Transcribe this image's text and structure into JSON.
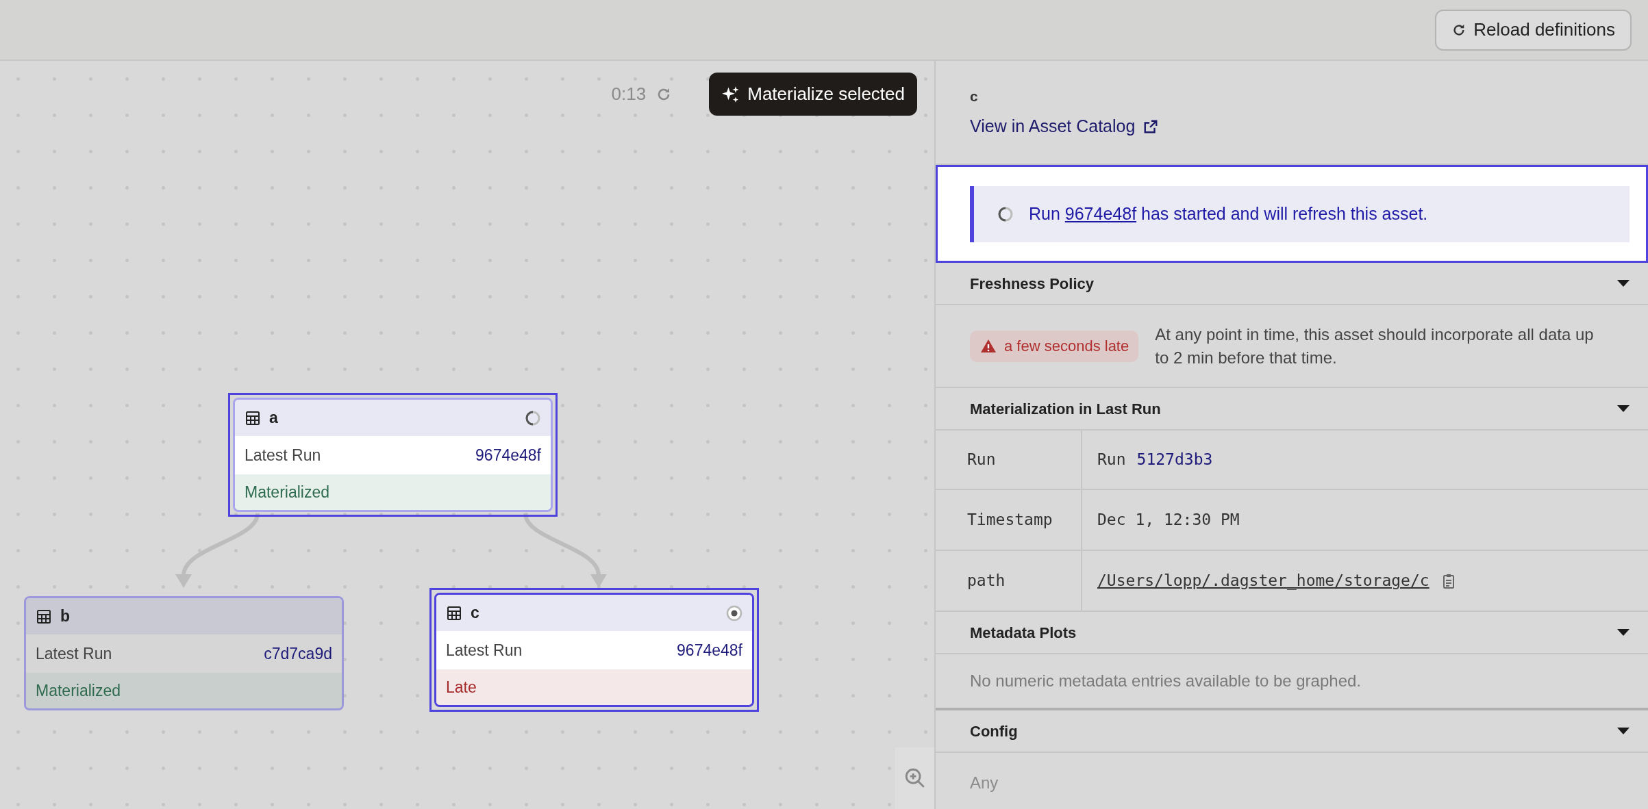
{
  "toolbar": {
    "reload_button": "Reload definitions"
  },
  "canvas": {
    "timer": "0:13",
    "materialize_button": "Materialize selected",
    "nodes": [
      {
        "name": "a",
        "row_label": "Latest Run",
        "run_id": "9674e48f",
        "status": "Materialized",
        "late": false,
        "selected": true,
        "spinner": true,
        "dot": false
      },
      {
        "name": "b",
        "row_label": "Latest Run",
        "run_id": "c7d7ca9d",
        "status": "Materialized",
        "late": false,
        "selected": false,
        "spinner": false,
        "dot": false
      },
      {
        "name": "c",
        "row_label": "Latest Run",
        "run_id": "9674e48f",
        "status": "Late",
        "late": true,
        "selected": true,
        "spinner": false,
        "dot": true
      }
    ]
  },
  "panel": {
    "asset_name": "c",
    "catalog_link": "View in Asset Catalog",
    "banner": {
      "prefix": "Run",
      "link": "9674e48f",
      "suffix": "has started and will refresh this asset."
    },
    "sections": [
      {
        "title": "Freshness Policy",
        "expanded": true,
        "kind": "freshness",
        "badge": "a few seconds late",
        "text": "At any point in time, this asset should incorporate all data up to 2 min before that time."
      },
      {
        "title": "Materialization in Last Run",
        "expanded": true,
        "kind": "table",
        "rows": [
          {
            "key": "Run",
            "kind": "run",
            "prefix": "Run",
            "value": "5127d3b3"
          },
          {
            "key": "Timestamp",
            "kind": "text",
            "value": "Dec 1, 12:30 PM"
          },
          {
            "key": "path",
            "kind": "path",
            "value": "/Users/lopp/.dagster_home/storage/c"
          }
        ]
      },
      {
        "title": "Metadata Plots",
        "expanded": true,
        "kind": "note",
        "text": "No numeric metadata entries available to be graphed."
      },
      {
        "title": "Config",
        "expanded": true,
        "kind": "note",
        "text": "Any"
      }
    ]
  }
}
